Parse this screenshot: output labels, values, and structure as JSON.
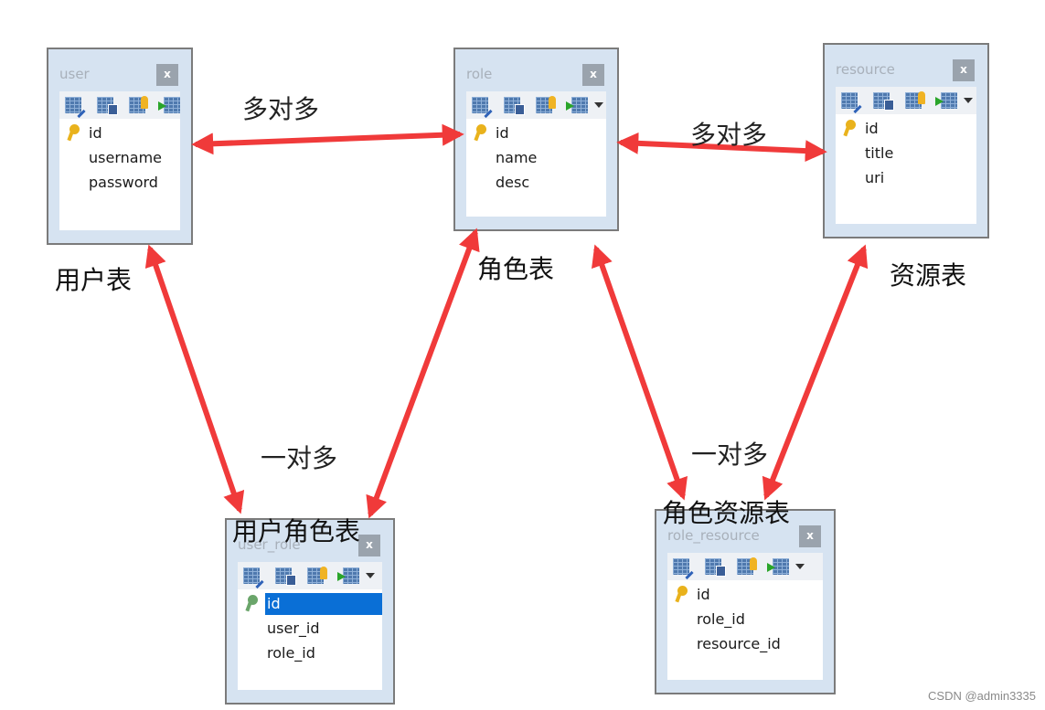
{
  "diagram": {
    "arrow_color": "#f03a3a",
    "tables": [
      {
        "id": "user",
        "title": "user",
        "caption": "用户表",
        "has_dropdown": false,
        "fields": [
          {
            "name": "id",
            "pk": true
          },
          {
            "name": "username",
            "pk": false
          },
          {
            "name": "password",
            "pk": false
          }
        ]
      },
      {
        "id": "role",
        "title": "role",
        "caption": "角色表",
        "has_dropdown": true,
        "fields": [
          {
            "name": "id",
            "pk": true
          },
          {
            "name": "name",
            "pk": false
          },
          {
            "name": "desc",
            "pk": false
          }
        ]
      },
      {
        "id": "resource",
        "title": "resource",
        "caption": "资源表",
        "has_dropdown": true,
        "fields": [
          {
            "name": "id",
            "pk": true
          },
          {
            "name": "title",
            "pk": false
          },
          {
            "name": "uri",
            "pk": false
          }
        ]
      },
      {
        "id": "user_role",
        "title": "user_role",
        "caption": "用户角色表",
        "has_dropdown": true,
        "fields": [
          {
            "name": "id",
            "pk": true,
            "selected": true
          },
          {
            "name": "user_id",
            "pk": false
          },
          {
            "name": "role_id",
            "pk": false
          }
        ]
      },
      {
        "id": "role_resource",
        "title": "role_resource",
        "caption": "角色资源表",
        "has_dropdown": true,
        "fields": [
          {
            "name": "id",
            "pk": true
          },
          {
            "name": "role_id",
            "pk": false
          },
          {
            "name": "resource_id",
            "pk": false
          }
        ]
      }
    ],
    "close_label": "x",
    "relations": [
      {
        "from": "user",
        "to": "role",
        "label": "多对多",
        "bidirectional": true
      },
      {
        "from": "role",
        "to": "resource",
        "label": "多对多",
        "bidirectional": true
      },
      {
        "from": "user",
        "to": "user_role",
        "label": "一对多",
        "bidirectional": true
      },
      {
        "from": "role",
        "to": "user_role",
        "label": "一对多",
        "bidirectional": true
      },
      {
        "from": "role",
        "to": "role_resource",
        "label": "一对多",
        "bidirectional": true
      },
      {
        "from": "resource",
        "to": "role_resource",
        "label": "一对多",
        "bidirectional": true
      }
    ]
  },
  "watermark": "CSDN @admin3335"
}
